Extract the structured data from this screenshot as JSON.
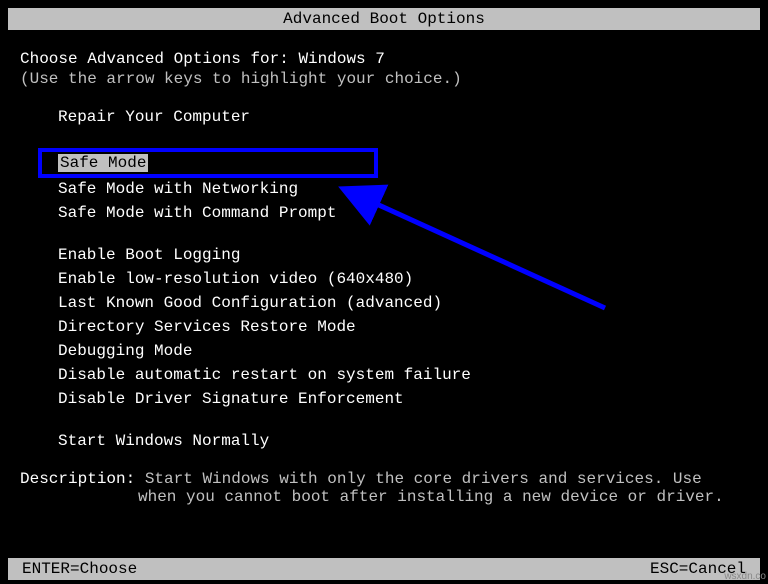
{
  "title": "Advanced Boot Options",
  "header": "Choose Advanced Options for: Windows 7",
  "hint": "(Use the arrow keys to highlight your choice.)",
  "menu": {
    "group1": [
      "Repair Your Computer"
    ],
    "selected": "Safe Mode",
    "group2": [
      "Safe Mode with Networking",
      "Safe Mode with Command Prompt"
    ],
    "group3": [
      "Enable Boot Logging",
      "Enable low-resolution video (640x480)",
      "Last Known Good Configuration (advanced)",
      "Directory Services Restore Mode",
      "Debugging Mode",
      "Disable automatic restart on system failure",
      "Disable Driver Signature Enforcement"
    ],
    "group4": [
      "Start Windows Normally"
    ]
  },
  "description": {
    "label": "Description:",
    "line1": "Start Windows with only the core drivers and services. Use",
    "line2": "when you cannot boot after installing a new device or driver."
  },
  "footer": {
    "enter": "ENTER=Choose",
    "esc": "ESC=Cancel"
  },
  "watermark": "wsxdn.co"
}
